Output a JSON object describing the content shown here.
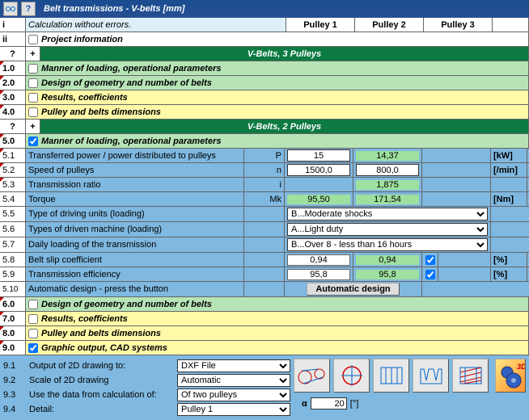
{
  "title": "Belt transmissions - V-belts [mm]",
  "status": {
    "i": "i",
    "label": "Calculation without errors.",
    "p1": "Pulley 1",
    "p2": "Pulley 2",
    "p3": "Pulley 3"
  },
  "row_ii": {
    "ii": "ii",
    "label": "Project information"
  },
  "section3p": {
    "q": "?",
    "plus": "+",
    "title": "V-Belts, 3 Pulleys"
  },
  "r10": {
    "n": "1.0",
    "label": "Manner of loading, operational parameters"
  },
  "r20": {
    "n": "2.0",
    "label": "Design of geometry and number of belts"
  },
  "r30": {
    "n": "3.0",
    "label": "Results, coefficients"
  },
  "r40": {
    "n": "4.0",
    "label": "Pulley and belts dimensions"
  },
  "section2p": {
    "q": "?",
    "plus": "+",
    "title": "V-Belts, 2 Pulleys"
  },
  "r50": {
    "n": "5.0",
    "label": "Manner of loading, operational parameters"
  },
  "r51": {
    "n": "5.1",
    "label": "Transferred power / power distributed to pulleys",
    "sym": "P",
    "v1": "15",
    "v2": "14,37",
    "unit": "[kW]"
  },
  "r52": {
    "n": "5.2",
    "label": "Speed of pulleys",
    "sym": "n",
    "v1": "1500,0",
    "v2": "800,0",
    "unit": "[/min]"
  },
  "r53": {
    "n": "5.3",
    "label": "Transmission ratio",
    "sym": "i",
    "v2": "1,875"
  },
  "r54": {
    "n": "5.4",
    "label": "Torque",
    "sym": "Mk",
    "v1": "95,50",
    "v2": "171,54",
    "unit": "[Nm]"
  },
  "r55": {
    "n": "5.5",
    "label": "Type of driving units (loading)",
    "opt": "B...Moderate shocks"
  },
  "r56": {
    "n": "5.6",
    "label": "Types of driven machine (loading)",
    "opt": "A...Light duty"
  },
  "r57": {
    "n": "5.7",
    "label": "Daily loading of the transmission",
    "opt": "B...Over 8 - less than 16 hours"
  },
  "r58": {
    "n": "5.8",
    "label": "Belt slip coefficient",
    "v1": "0,94",
    "v2": "0,94",
    "unit": "[%]"
  },
  "r59": {
    "n": "5.9",
    "label": "Transmission efficiency",
    "v1": "95,8",
    "v2": "95,8",
    "unit": "[%]"
  },
  "r510": {
    "n": "5.10",
    "label": "Automatic design - press the button",
    "btn": "Automatic design"
  },
  "r60": {
    "n": "6.0",
    "label": "Design of geometry and number of belts"
  },
  "r70": {
    "n": "7.0",
    "label": "Results, coefficients"
  },
  "r80": {
    "n": "8.0",
    "label": "Pulley and belts dimensions"
  },
  "r90": {
    "n": "9.0",
    "label": "Graphic output, CAD systems"
  },
  "r91": {
    "n": "9.1",
    "label": "Output of 2D drawing to:",
    "opt": "DXF File"
  },
  "r92": {
    "n": "9.2",
    "label": "Scale of 2D drawing",
    "opt": "Automatic"
  },
  "r93": {
    "n": "9.3",
    "label": "Use the data from calculation of:",
    "opt": "Of two pulleys"
  },
  "r94": {
    "n": "9.4",
    "label": "Detail:",
    "opt": "Pulley 1"
  },
  "alpha": {
    "sym": "α",
    "val": "20",
    "unit": "[°]"
  }
}
